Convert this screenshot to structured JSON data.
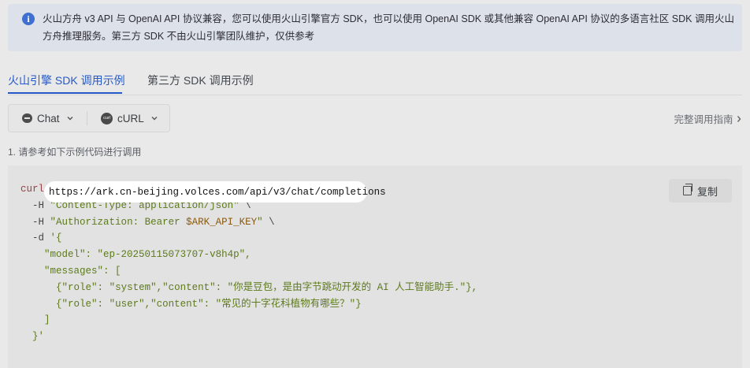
{
  "notice": {
    "icon": "info-icon",
    "text": "火山方舟 v3 API 与 OpenAI API 协议兼容，您可以使用火山引擎官方 SDK，也可以使用 OpenAI SDK 或其他兼容 OpenAI API 协议的多语言社区 SDK 调用火山方舟推理服务。第三方 SDK 不由火山引擎团队维护，仅供参考"
  },
  "tabs": [
    {
      "label": "火山引擎 SDK 调用示例",
      "active": true
    },
    {
      "label": "第三方 SDK 调用示例",
      "active": false
    }
  ],
  "selectors": {
    "api": {
      "label": "Chat",
      "icon": "chat-icon"
    },
    "language": {
      "label": "cURL",
      "icon": "curl-icon",
      "icon_text": "curl"
    }
  },
  "guide_link": "完整调用指南",
  "step": "1. 请参考如下示例代码进行调用",
  "copy_label": "复制",
  "code": {
    "cmd": "curl",
    "url": "https://ark.cn-beijing.volces.com/api/v3/chat/completions",
    "cont": "\\",
    "h1_flag": "-H",
    "h1": "\"Content-Type: application/json\"",
    "h2_flag": "-H",
    "h2_a": "\"Authorization: Bearer ",
    "h2_var": "$ARK_API_KEY",
    "h2_b": "\"",
    "d_flag": "-d",
    "body_open": "'{",
    "model_key": "\"model\"",
    "model_val": "\"ep-20250115073707-v8h4p\"",
    "messages_key": "\"messages\"",
    "arr_open": "[",
    "m1_open": "{",
    "role_key": "\"role\"",
    "m1_role": "\"system\"",
    "content_key": "\"content\"",
    "m1_content": "\"你是豆包，是由字节跳动开发的 AI 人工智能助手.\"",
    "m1_close": "},",
    "m2_open": "{",
    "m2_role": "\"user\"",
    "m2_content": "\"常见的十字花科植物有哪些？\"",
    "m2_close": "}",
    "arr_close": "]",
    "body_close": "}'"
  }
}
